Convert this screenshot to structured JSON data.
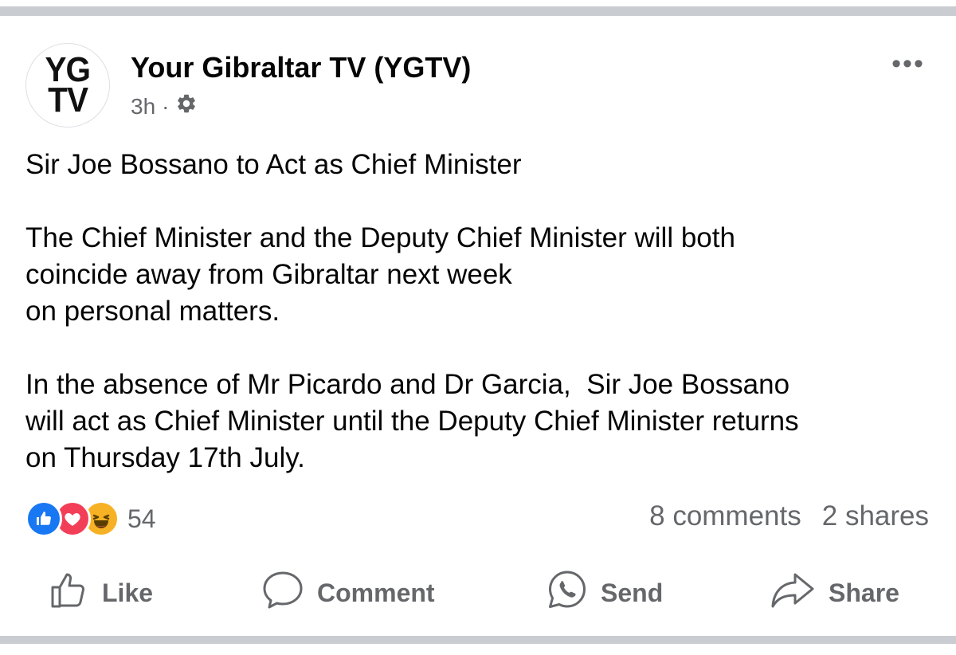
{
  "post": {
    "page_name": "Your Gibraltar TV (YGTV)",
    "avatar_text": [
      "YG",
      "TV"
    ],
    "timestamp": "3h",
    "separator": "·",
    "privacy_icon": "gear-icon",
    "more_icon": "more-dots-icon",
    "more_label": "•••",
    "title": "Sir Joe Bossano to Act as Chief Minister",
    "paragraph1_lines": [
      "The Chief Minister and the Deputy Chief Minister will both",
      "coincide away from Gibraltar next week",
      "on personal matters."
    ],
    "paragraph2_lines": [
      "In the absence of Mr Picardo and Dr Garcia,  Sir Joe Bossano",
      "will act as Chief Minister until the Deputy Chief Minister returns",
      "on Thursday 17th July."
    ]
  },
  "stats": {
    "reaction_icons": [
      "like-reaction-icon",
      "love-reaction-icon",
      "haha-reaction-icon"
    ],
    "reaction_count": "54",
    "comments": "8 comments",
    "shares": "2 shares"
  },
  "actions": {
    "like": "Like",
    "comment": "Comment",
    "send": "Send",
    "share": "Share"
  },
  "colors": {
    "like_blue": "#1877f2",
    "love_red": "#f33e58",
    "haha_yellow": "#f7b125",
    "secondary_text": "#65676b",
    "divider": "#c9ccd1"
  }
}
